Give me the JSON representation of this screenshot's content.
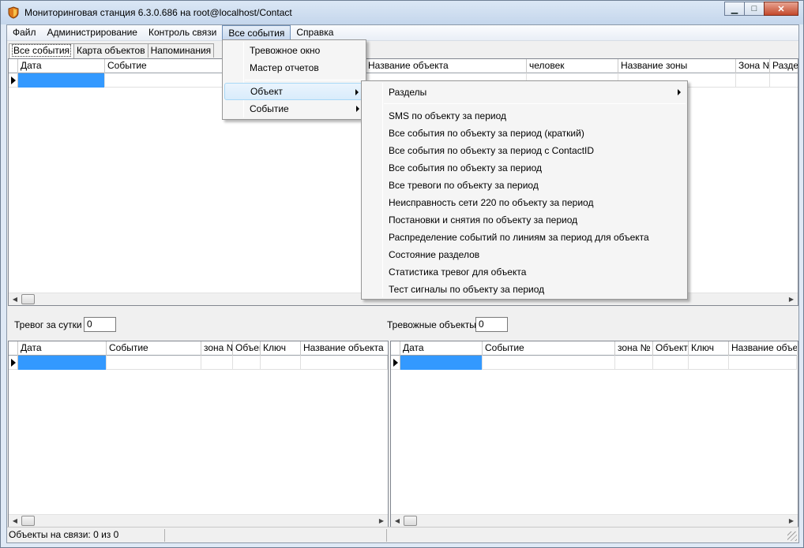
{
  "window": {
    "title": "Мониторинговая станция 6.3.0.686 на root@localhost/Contact",
    "buttons": {
      "minimize": "▁",
      "maximize": "□",
      "close": "✕"
    }
  },
  "menubar": {
    "items": [
      "Файл",
      "Администрирование",
      "Контроль связи",
      "Все события",
      "Справка"
    ],
    "active": "Все события"
  },
  "tabs": [
    "Все события",
    "Карта объектов",
    "Напоминания"
  ],
  "main_grid": {
    "columns": [
      "Дата",
      "Событие",
      "",
      "Название объекта",
      "человек",
      "Название зоны",
      "Зона №",
      "Разде..."
    ]
  },
  "menu_all_events": {
    "items": [
      "Тревожное окно",
      "Мастер отчетов",
      "Объект",
      "Событие"
    ]
  },
  "menu_object": {
    "items": [
      "Разделы",
      "SMS по объекту за период",
      "Все события по объекту за период (краткий)",
      "Все события по объекту за период с ContactID",
      "Все события по объекту за период",
      "Все тревоги по объекту за период",
      "Неисправность сети 220 по объекту за период",
      "Постановки и снятия по объекту за период",
      "Распределение событий по линиям за период для объекта",
      "Состояние разделов",
      "Статистика тревог для объекта",
      "Тест сигналы по объекту за период"
    ]
  },
  "alarms_per_day": {
    "label": "Тревог за сутки",
    "value": "0"
  },
  "alarm_objects": {
    "label": "Тревожные объекты",
    "value": "0"
  },
  "left_grid": {
    "columns": [
      "Дата",
      "Событие",
      "зона №",
      "Объект",
      "Ключ",
      "Название объекта"
    ]
  },
  "right_grid": {
    "columns": [
      "Дата",
      "Событие",
      "зона №",
      "Объект",
      "Ключ",
      "Название объек"
    ]
  },
  "status": {
    "connected": "Объекты на связи: 0 из 0"
  },
  "icons": {
    "app": "shield-icon",
    "submenu": "chevron-right-icon",
    "row_pointer": "row-pointer-icon"
  },
  "colors": {
    "selection": "#3399ff",
    "menu_highlight": "#d9ecfb"
  }
}
